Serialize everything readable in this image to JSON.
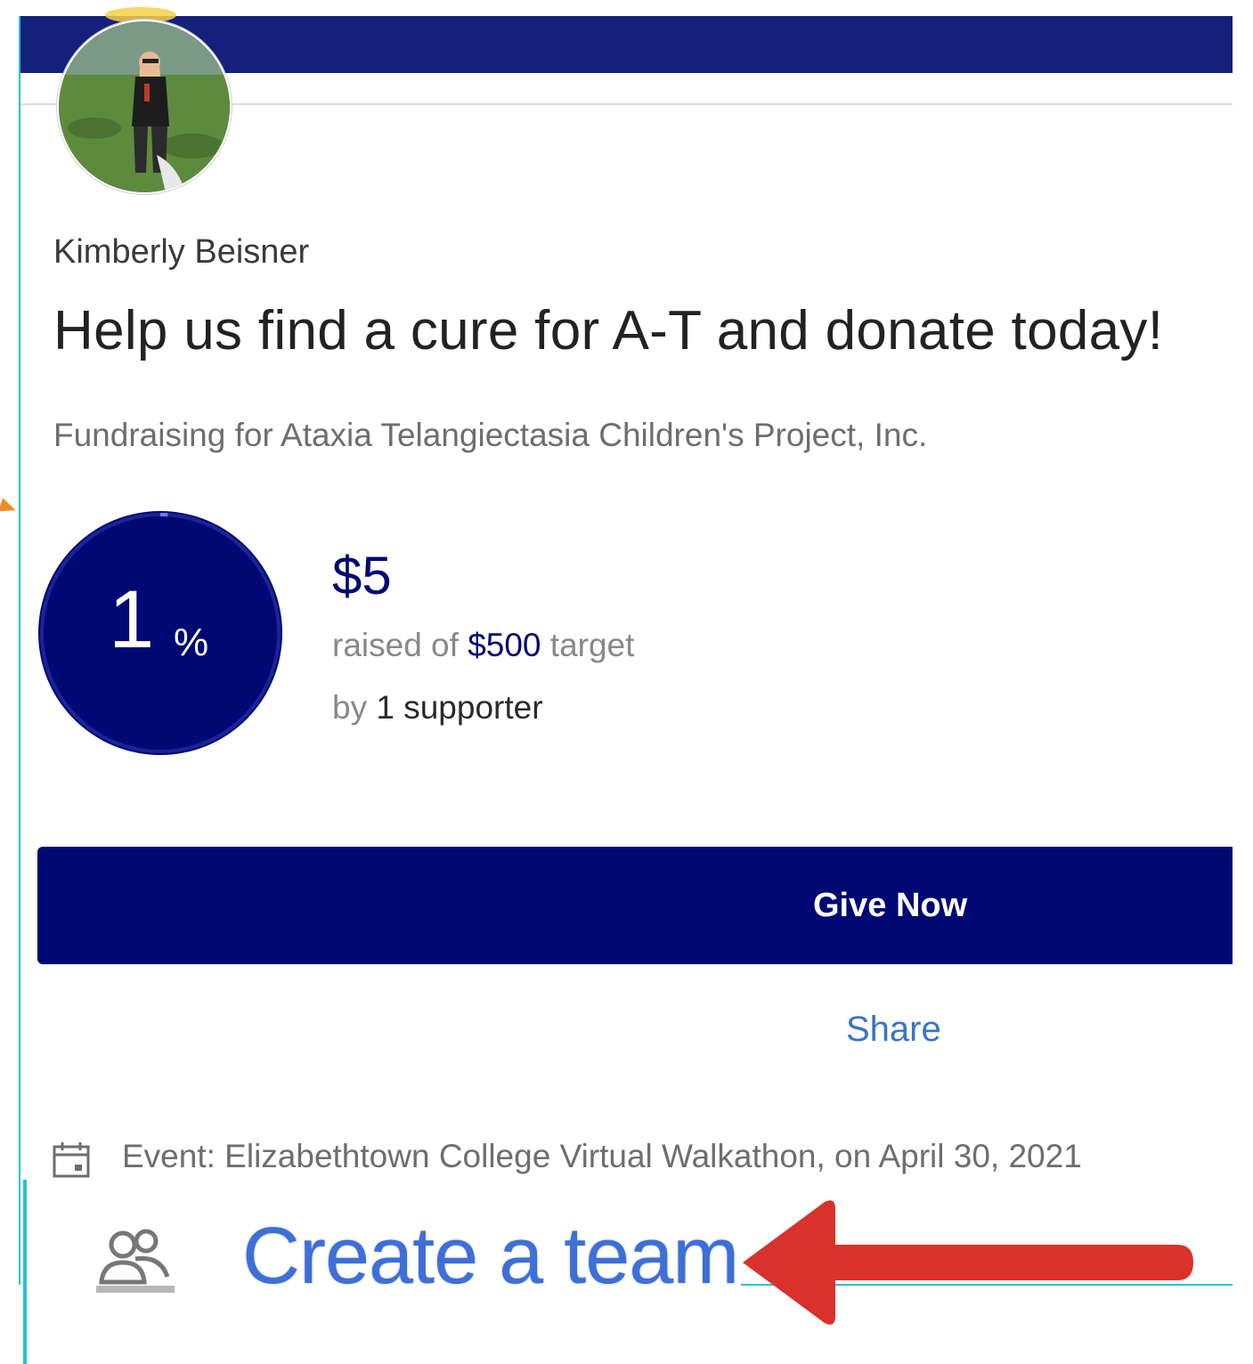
{
  "fundraiser": {
    "owner_name": "Kimberly Beisner",
    "title": "Help us find a cure for A-T and donate today!",
    "charity_line": "Fundraising for Ataxia Telangiectasia Children's Project, Inc."
  },
  "progress": {
    "percent_value": "1",
    "percent_symbol": "%",
    "percent_fraction": 0.01,
    "amount_raised": "$5",
    "raised_prefix": "raised of ",
    "target_amount": "$500",
    "raised_suffix": " target",
    "supporter_prefix": "by ",
    "supporter_count_text": "1 supporter"
  },
  "actions": {
    "give_label": "Give Now",
    "share_label": "Share",
    "create_team_label": "Create a team"
  },
  "event": {
    "text": "Event: Elizabethtown College Virtual Walkathon, on April 30, 2021"
  },
  "colors": {
    "banner": "#15207a",
    "primary": "#000873",
    "link": "#3a74c8",
    "frame": "#22c3d6",
    "annotation_arrow": "#d9312b"
  },
  "icons": {
    "event": "calendar-icon",
    "team": "team-icon",
    "annotation": "arrow-left-icon"
  }
}
